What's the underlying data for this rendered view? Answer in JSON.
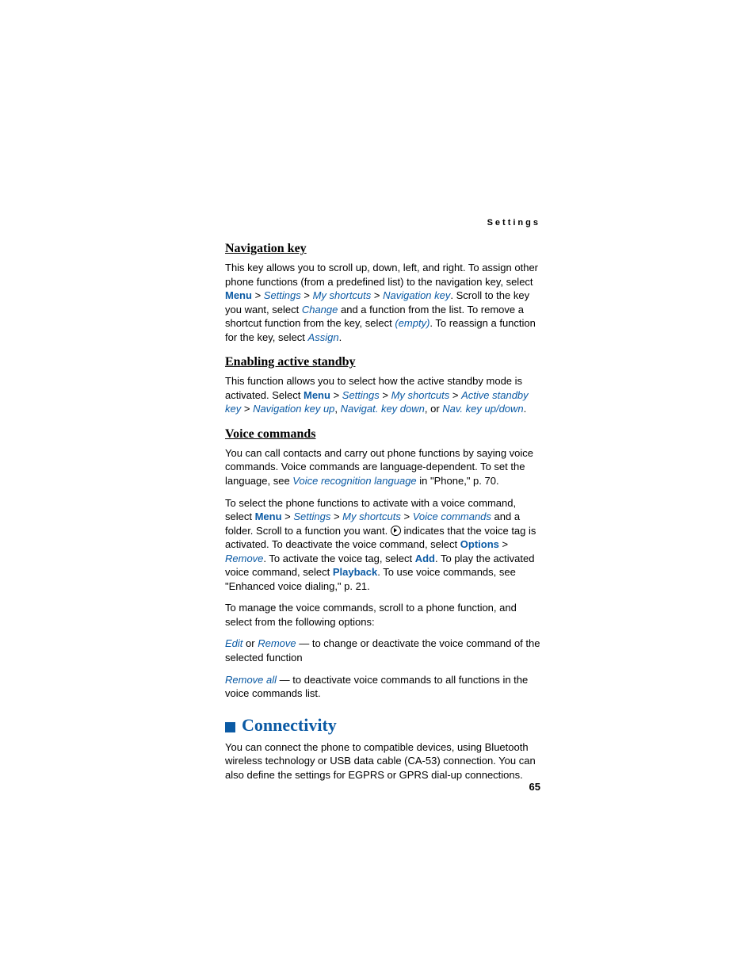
{
  "runningHeader": "Settings",
  "pageNumber": "65",
  "sections": {
    "navKey": {
      "heading": "Navigation key",
      "p1a": "This key allows you to scroll up, down, left, and right. To assign other phone functions (from a predefined list) to the navigation key, select ",
      "menu": "Menu",
      "gt": " > ",
      "settings": "Settings",
      "myShortcuts": "My shortcuts",
      "navKey": "Navigation key",
      "p1b": ". Scroll to the key you want, select ",
      "change": "Change",
      "p1c": " and a function from the list. To remove a shortcut function from the key, select ",
      "empty": "(empty)",
      "p1d": ". To reassign a function for the key, select ",
      "assign": "Assign",
      "period": "."
    },
    "standby": {
      "heading": "Enabling active standby",
      "p1a": "This function allows you to select how the active standby mode is activated. Select ",
      "menu": "Menu",
      "gt": " > ",
      "settings": "Settings",
      "myShortcuts": "My shortcuts",
      "activeKey": "Active standby key",
      "navUp": "Navigation key up",
      "comma": ", ",
      "navDown": "Navigat. key down",
      "or": ", or ",
      "navUpDown": "Nav. key up/down",
      "period": "."
    },
    "voice": {
      "heading": "Voice commands",
      "p1a": "You can call contacts and carry out phone functions by saying voice commands. Voice commands are language-dependent. To set the language, see ",
      "vrLang": "Voice recognition language",
      "p1b": " in \"Phone,\" p. 70.",
      "p2a": "To select the phone functions to activate with a voice command, select ",
      "menu": "Menu",
      "gt": " > ",
      "settings": "Settings",
      "myShortcuts": "My shortcuts",
      "voiceCmds": "Voice commands",
      "p2b": " and a folder. Scroll to a function you want. ",
      "p2c": " indicates that the voice tag is activated. To deactivate the voice command, select ",
      "options": "Options",
      "remove": "Remove",
      "p2d": ". To activate the voice tag, select ",
      "add": "Add",
      "p2e": ". To play the activated voice command, select ",
      "playback": "Playback",
      "p2f": ". To use voice commands, see \"Enhanced voice dialing,\" p. 21.",
      "p3": "To manage the voice commands, scroll to a phone function, and select from the following options:",
      "edit": "Edit",
      "orText": " or ",
      "remove2": "Remove",
      "p4a": " — to change or deactivate the voice command of the selected function",
      "removeAll": "Remove all",
      "p5a": " — to deactivate voice commands to all functions in the voice commands list."
    },
    "connectivity": {
      "heading": "Connectivity",
      "p1": "You can connect the phone to compatible devices, using Bluetooth wireless technology or USB data cable (CA-53) connection. You can also define the settings for EGPRS or GPRS dial-up connections."
    }
  }
}
